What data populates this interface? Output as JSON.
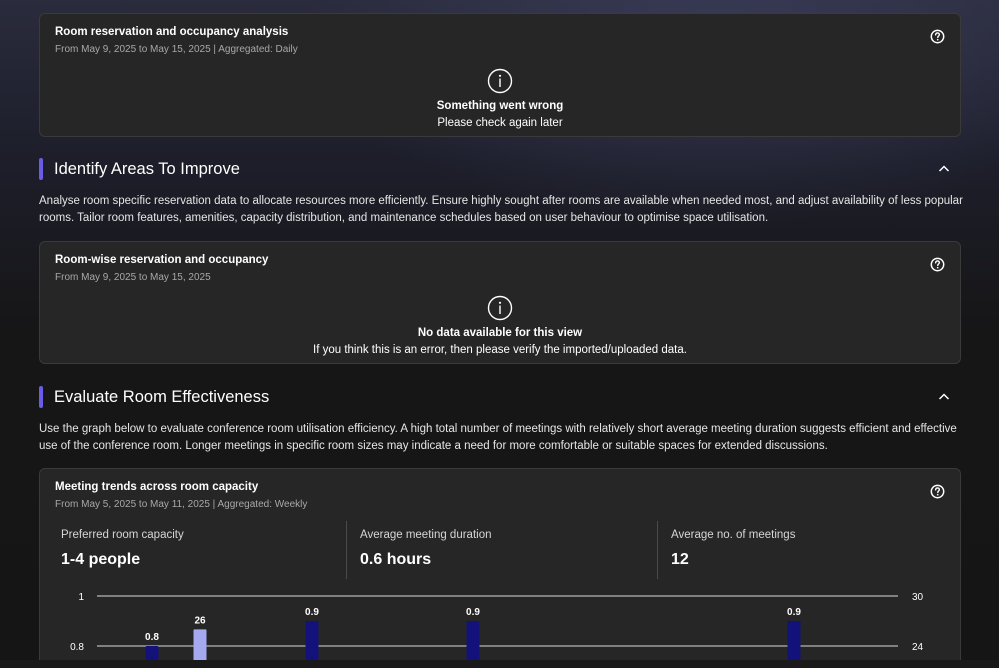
{
  "card1": {
    "title": "Room reservation and occupancy analysis",
    "subtitle": "From May 9, 2025 to May 15, 2025 | Aggregated: Daily",
    "message_title": "Something went wrong",
    "message_text": "Please check again later"
  },
  "section1": {
    "title": "Identify Areas To Improve",
    "description": "Analyse room specific reservation data to allocate resources more efficiently. Ensure highly sought after rooms are available when needed most, and adjust availability of less popular rooms. Tailor room features, amenities, capacity distribution, and maintenance schedules based on user behaviour to optimise space utilisation."
  },
  "card2": {
    "title": "Room-wise reservation and occupancy",
    "subtitle": "From May 9, 2025 to May 15, 2025",
    "message_title": "No data available for this view",
    "message_text": "If you think this is an error, then please verify the imported/uploaded data."
  },
  "section2": {
    "title": "Evaluate Room Effectiveness",
    "description": "Use the graph below to evaluate conference room utilisation efficiency. A high total number of meetings with relatively short average meeting duration suggests efficient and effective use of the conference room. Longer meetings in specific room sizes may indicate a need for more comfortable or suitable spaces for extended discussions."
  },
  "card3": {
    "title": "Meeting trends across room capacity",
    "subtitle": "From May 5, 2025 to May 11, 2025 | Aggregated: Weekly",
    "kpis": [
      {
        "label": "Preferred room capacity",
        "value": "1-4 people"
      },
      {
        "label": "Average meeting duration",
        "value": "0.6 hours"
      },
      {
        "label": "Average no. of meetings",
        "value": "12"
      }
    ]
  },
  "chart_data": {
    "type": "bar",
    "left_axis_ticks": [
      "1",
      "0.8"
    ],
    "right_axis_ticks": [
      "30",
      "24"
    ],
    "left_ylim": [
      0.8,
      1
    ],
    "right_ylim": [
      24,
      30
    ],
    "bars": [
      {
        "axis": "left",
        "value": 0.8,
        "label": "0.8",
        "color": "#12127a"
      },
      {
        "axis": "right",
        "value": 26,
        "label": "26",
        "color": "#a5a9f0"
      },
      {
        "axis": "left",
        "value": 0.9,
        "label": "0.9",
        "color": "#12127a"
      },
      {
        "axis": "left",
        "value": 0.9,
        "label": "0.9",
        "color": "#12127a"
      },
      {
        "axis": "left",
        "value": 0.9,
        "label": "0.9",
        "color": "#12127a"
      }
    ]
  },
  "colors": {
    "accent": "#6b5ce7",
    "bar_dark": "#12127a",
    "bar_light": "#a5a9f0"
  },
  "icons": {
    "help": "question-circle-icon",
    "info": "info-circle-icon",
    "chevron": "chevron-up-icon"
  }
}
